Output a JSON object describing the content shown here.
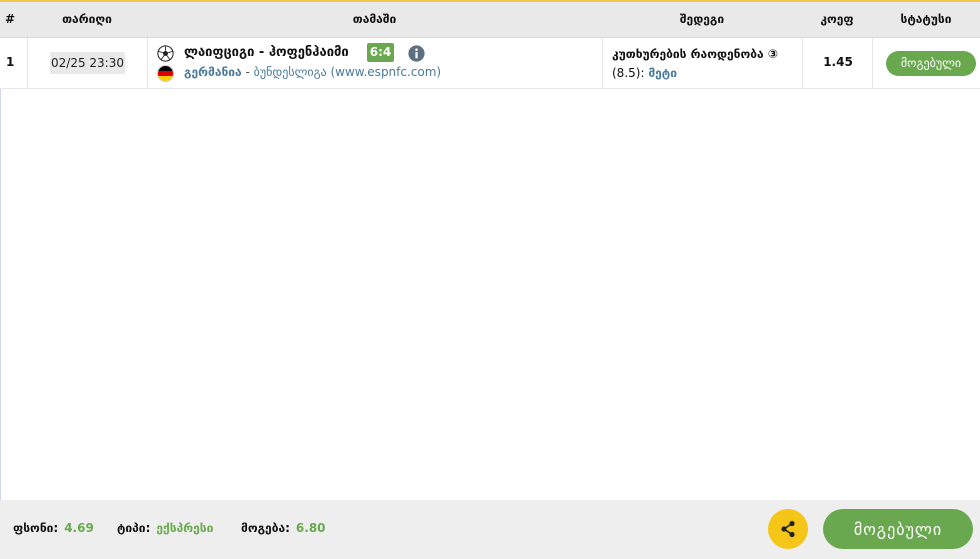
{
  "header": {
    "col_num": "#",
    "col_date": "თარიღი",
    "col_match": "თამაში",
    "col_market": "შედეგი",
    "col_odds": "კოეფ",
    "col_status": "სტატუსი"
  },
  "row": {
    "num": "1",
    "date": "02/25 23:30",
    "sport_icon": "soccer-ball-icon",
    "match": "ლაიფციგი - ჰოფენჰაიმი",
    "score": "6:4",
    "country_flag": "germany-flag-icon",
    "country": "გერმანია",
    "separator": " - ",
    "league": "ბუნდესლიგა (www.espnfc.com)",
    "market": "კუთხურების რაოდენობა ③",
    "line": "(8.5):",
    "pick": "მეტი",
    "odds": "1.45",
    "status": "მოგებული"
  },
  "footer": {
    "total_odds_label": "ფსონი:",
    "total_odds_value": "4.69",
    "type_label": "ტიპი:",
    "type_value": "ექსპრესი",
    "win_label": "მოგება:",
    "win_value": "6.80",
    "share_icon": "share-icon",
    "result_button": "მოგებული"
  },
  "colors": {
    "accent_green": "#6aa84f",
    "share_yellow": "#f5c518",
    "header_bg": "#e9e9e9",
    "link_blue": "#4a7a99"
  }
}
